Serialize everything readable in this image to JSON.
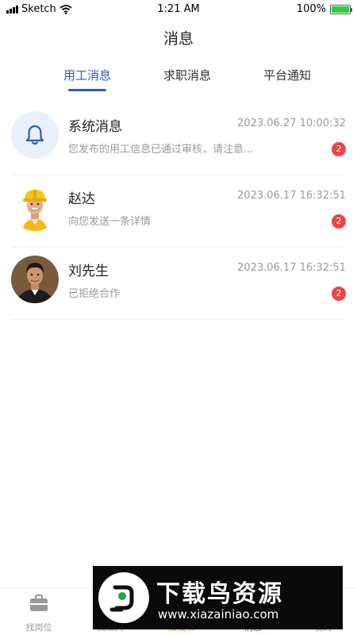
{
  "status_bar": {
    "carrier": "Sketch",
    "time": "1:21 AM",
    "battery": "100%",
    "battery_level": 1.0
  },
  "page": {
    "title": "消息"
  },
  "tabs": [
    {
      "label": "用工消息",
      "active": true
    },
    {
      "label": "求职消息",
      "active": false
    },
    {
      "label": "平台通知",
      "active": false
    }
  ],
  "messages": [
    {
      "name": "系统消息",
      "time": "2023.06.27 10:00:32",
      "preview": "您发布的用工信息已通过审核，请注意...",
      "badge": "2",
      "avatar": "bell-icon"
    },
    {
      "name": "赵达",
      "time": "2023.06.17 16:32:51",
      "preview": "向您发送一条详情",
      "badge": "2",
      "avatar": "worker-avatar"
    },
    {
      "name": "刘先生",
      "time": "2023.06.17 16:32:51",
      "preview": "已拒绝合作",
      "badge": "2",
      "avatar": "man-avatar"
    }
  ],
  "tabbar": {
    "items": [
      {
        "label": "找岗位",
        "icon": "briefcase-icon"
      },
      {
        "label": "找工人",
        "icon": "workers-icon"
      },
      {
        "label": "去发布",
        "icon": "publish-icon"
      },
      {
        "label": "消息",
        "icon": "message-icon"
      },
      {
        "label": "我的",
        "icon": "profile-icon"
      }
    ]
  },
  "watermark": {
    "title": "下载鸟资源",
    "url": "www.xiazainiao.com"
  },
  "colors": {
    "accent": "#2d5fb3",
    "badge": "#e8474a",
    "muted_text": "#9a9a9a"
  }
}
